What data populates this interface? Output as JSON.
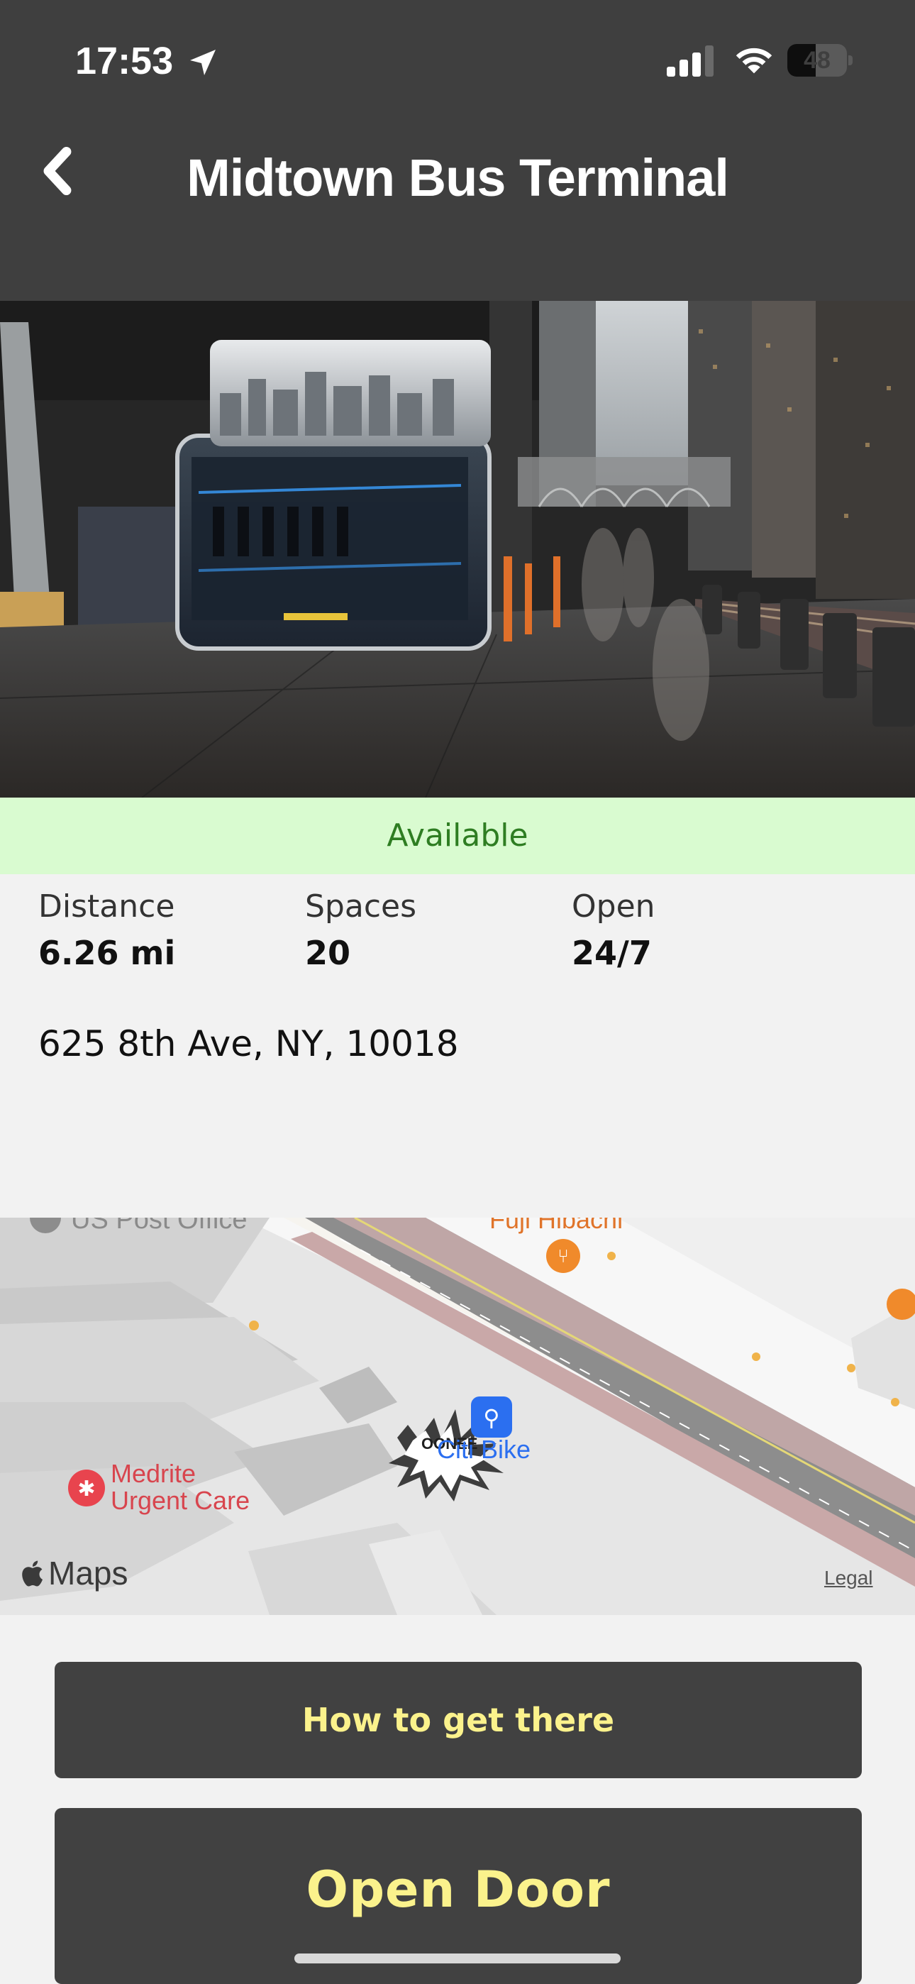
{
  "status_bar": {
    "time": "17:53",
    "battery_level": "48",
    "battery_fraction": 0.48,
    "icons": [
      "location-arrow-icon",
      "cellular-signal-icon",
      "wifi-icon",
      "battery-icon"
    ]
  },
  "header": {
    "title": "Midtown Bus Terminal",
    "back_icon": "chevron-left-icon",
    "background": "#3f3f3f"
  },
  "status": {
    "label": "Available",
    "color": "#2e7d22",
    "background": "#d9fbd0"
  },
  "info": {
    "distance_label": "Distance",
    "distance_value": "6.26 mi",
    "spaces_label": "Spaces",
    "spaces_value": "20",
    "open_label": "Open",
    "open_value": "24/7"
  },
  "address": "625 8th Ave, NY, 10018",
  "map": {
    "labels": {
      "post_office": "US Post Office",
      "restaurant": "Fuji Hibachi",
      "urgent_care_line1": "Medrite",
      "urgent_care_line2": "Urgent Care",
      "bike_station": "Citi Bike",
      "station_marker": "OONEE"
    },
    "attribution": "Maps",
    "legal": "Legal"
  },
  "actions": {
    "directions_label": "How to get there",
    "open_door_label": "Open Door",
    "button_text_color": "#fbf28c"
  }
}
